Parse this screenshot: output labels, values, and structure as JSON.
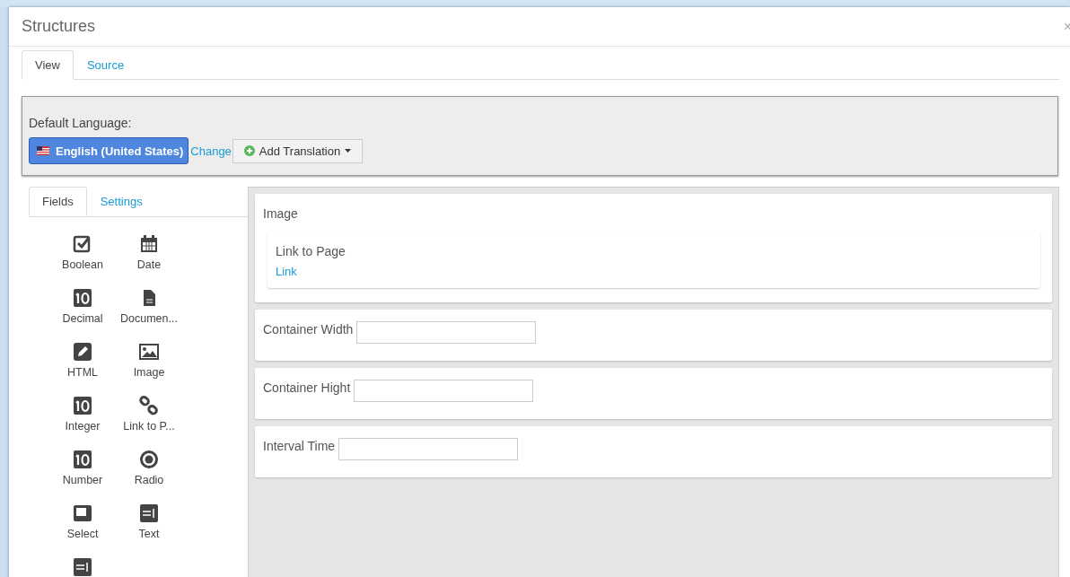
{
  "dialog": {
    "title": "Structures",
    "close": "×"
  },
  "tabs": [
    {
      "label": "View",
      "selected": true
    },
    {
      "label": "Source",
      "selected": false
    }
  ],
  "language": {
    "label": "Default Language:",
    "current": "English (United States)",
    "change": "Change",
    "add_translation": "Add Translation"
  },
  "palette_tabs": [
    {
      "label": "Fields",
      "selected": true
    },
    {
      "label": "Settings",
      "selected": false
    }
  ],
  "field_types": [
    {
      "kind": "boolean",
      "label": "Boolean"
    },
    {
      "kind": "date",
      "label": "Date"
    },
    {
      "kind": "decimal",
      "label": "Decimal"
    },
    {
      "kind": "document",
      "label": "Documen..."
    },
    {
      "kind": "html",
      "label": "HTML"
    },
    {
      "kind": "image",
      "label": "Image"
    },
    {
      "kind": "integer",
      "label": "Integer"
    },
    {
      "kind": "link",
      "label": "Link to P..."
    },
    {
      "kind": "number",
      "label": "Number"
    },
    {
      "kind": "radio",
      "label": "Radio"
    },
    {
      "kind": "select",
      "label": "Select"
    },
    {
      "kind": "text",
      "label": "Text"
    },
    {
      "kind": "textbox"
    }
  ],
  "form_fields": [
    {
      "kind": "group",
      "label": "Image",
      "children": [
        {
          "label": "Link to Page",
          "link": "Link"
        }
      ]
    },
    {
      "kind": "input",
      "label": "Container Width"
    },
    {
      "kind": "input",
      "label": "Container Hight"
    },
    {
      "kind": "input",
      "label": "Interval Time"
    }
  ]
}
